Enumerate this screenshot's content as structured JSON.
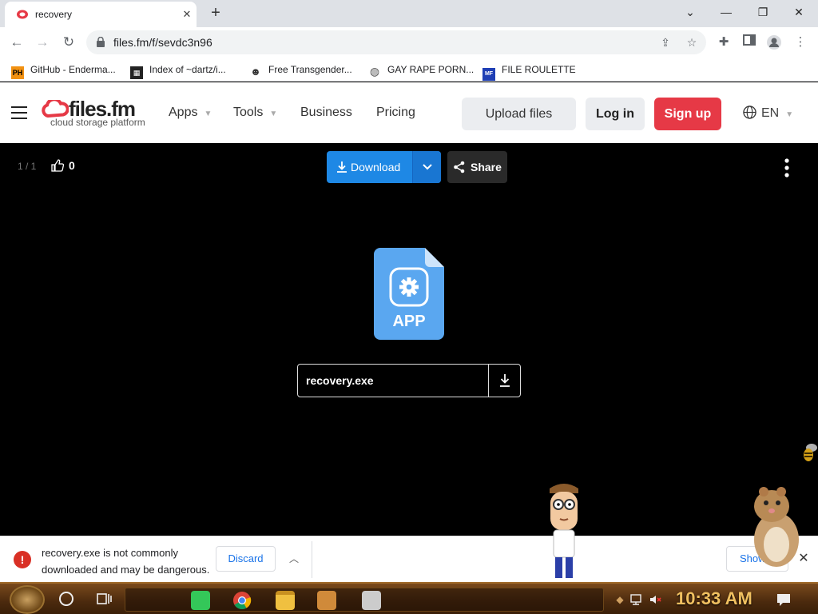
{
  "browser": {
    "tab_title": "recovery",
    "tab_close": "✕",
    "new_tab": "+",
    "url": "files.fm/f/sevdc3n96",
    "window_controls": {
      "minimize": "—",
      "restore": "❐",
      "close": "✕",
      "tab_search": "⌄"
    }
  },
  "bookmarks": [
    {
      "icon_text": "PH",
      "label": "GitHub - Enderma...",
      "icon_color": "#f29111"
    },
    {
      "icon_text": "▦",
      "label": "Index of ~dartz/i...",
      "icon_color": "#000000"
    },
    {
      "icon_text": "☻",
      "label": "Free Transgender...",
      "icon_color": "#333333"
    },
    {
      "icon_text": "◍",
      "label": "GAY RAPE PORN...",
      "icon_color": "#555555"
    },
    {
      "icon_text": "MF",
      "label": "FILE ROULETTE",
      "icon_color": "#1f3fb5"
    }
  ],
  "site": {
    "logo_name": "files.fm",
    "logo_tagline": "cloud storage platform",
    "nav": {
      "apps": "Apps",
      "tools": "Tools",
      "business": "Business",
      "pricing": "Pricing"
    },
    "upload_label": "Upload files",
    "login_label": "Log in",
    "signup_label": "Sign up",
    "language": "EN",
    "brand_color": "#e63946"
  },
  "viewer": {
    "pager": "1 / 1",
    "likes": "0",
    "download_label": "Download",
    "share_label": "Share",
    "file_type_label": "APP",
    "filename": "recovery.exe",
    "accent_color": "#1e88e5"
  },
  "download_bar": {
    "warning_text": "recovery.exe is not commonly downloaded and may be dangerous.",
    "discard_label": "Discard",
    "show_label": "Show",
    "close_label": "✕"
  },
  "taskbar": {
    "clock": "10:33 AM"
  }
}
